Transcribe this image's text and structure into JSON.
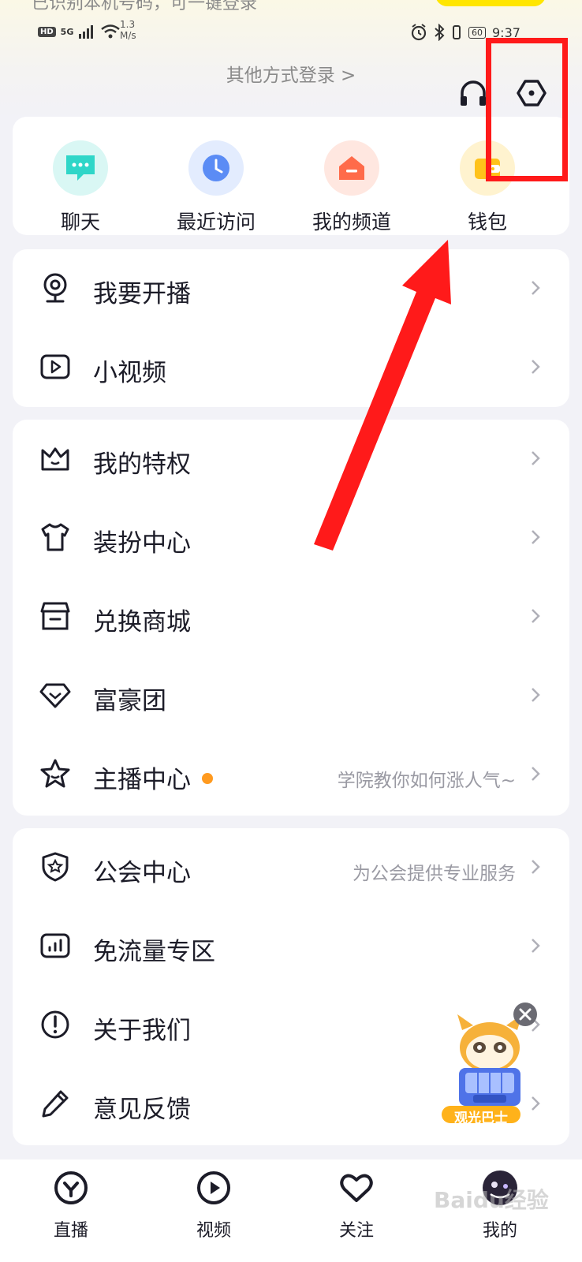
{
  "top_cut_text": "已识别本机号码，可一键登录",
  "status_bar": {
    "hd": "HD",
    "network": "5G",
    "speed_value": "1.3",
    "speed_unit": "M/s",
    "battery": "60",
    "time": "9:37"
  },
  "header": {
    "other_login": "其他方式登录 >",
    "headset_icon": "headphones-icon",
    "settings_icon": "settings-hexagon-icon"
  },
  "quick_actions": [
    {
      "label": "聊天",
      "icon": "chat-bubble-icon",
      "color": "#2fd6c8"
    },
    {
      "label": "最近访问",
      "icon": "clock-icon",
      "color": "#5b8cf5"
    },
    {
      "label": "我的频道",
      "icon": "home-channel-icon",
      "color": "#ff6b4a"
    },
    {
      "label": "钱包",
      "icon": "wallet-icon",
      "color": "#ffc21a"
    }
  ],
  "group1": [
    {
      "label": "我要开播",
      "icon": "webcam-icon"
    },
    {
      "label": "小视频",
      "icon": "video-play-icon"
    }
  ],
  "group2": [
    {
      "label": "我的特权",
      "icon": "crown-icon"
    },
    {
      "label": "装扮中心",
      "icon": "tshirt-icon"
    },
    {
      "label": "兑换商城",
      "icon": "store-icon"
    },
    {
      "label": "富豪团",
      "icon": "diamond-icon"
    },
    {
      "label": "主播中心",
      "icon": "star-icon",
      "sub": "学院教你如何涨人气~",
      "dot_color": "#ff9a1f"
    }
  ],
  "group3": [
    {
      "label": "公会中心",
      "icon": "shield-star-icon",
      "sub": "为公会提供专业服务"
    },
    {
      "label": "免流量专区",
      "icon": "data-bars-icon"
    },
    {
      "label": "关于我们",
      "icon": "info-icon"
    },
    {
      "label": "意见反馈",
      "icon": "pencil-icon"
    }
  ],
  "floating_ad": {
    "label": "观光巴士",
    "close_icon": "close-circle-icon"
  },
  "tabbar": [
    {
      "label": "直播",
      "icon": "live-icon"
    },
    {
      "label": "视频",
      "icon": "video-tab-icon"
    },
    {
      "label": "关注",
      "icon": "heart-icon"
    },
    {
      "label": "我的",
      "icon": "avatar-icon"
    }
  ],
  "watermark": "Baidu经验"
}
